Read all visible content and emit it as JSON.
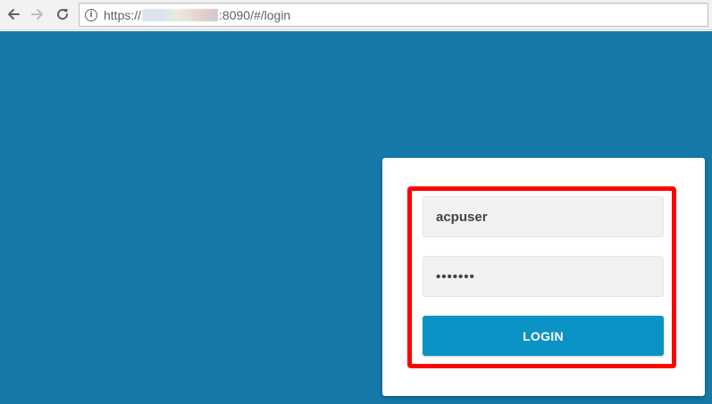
{
  "browser": {
    "back_icon": "arrow-left-icon",
    "forward_icon": "arrow-right-icon",
    "reload_icon": "reload-icon",
    "info_icon": "info-icon",
    "url_prefix": "https://",
    "url_suffix": ":8090/#/login"
  },
  "login_form": {
    "username_value": "acpuser",
    "password_value": "•••••••",
    "login_label": "LOGIN"
  },
  "colors": {
    "page_background": "#1679a9",
    "button": "#0b93c6",
    "highlight": "#ff0000"
  }
}
